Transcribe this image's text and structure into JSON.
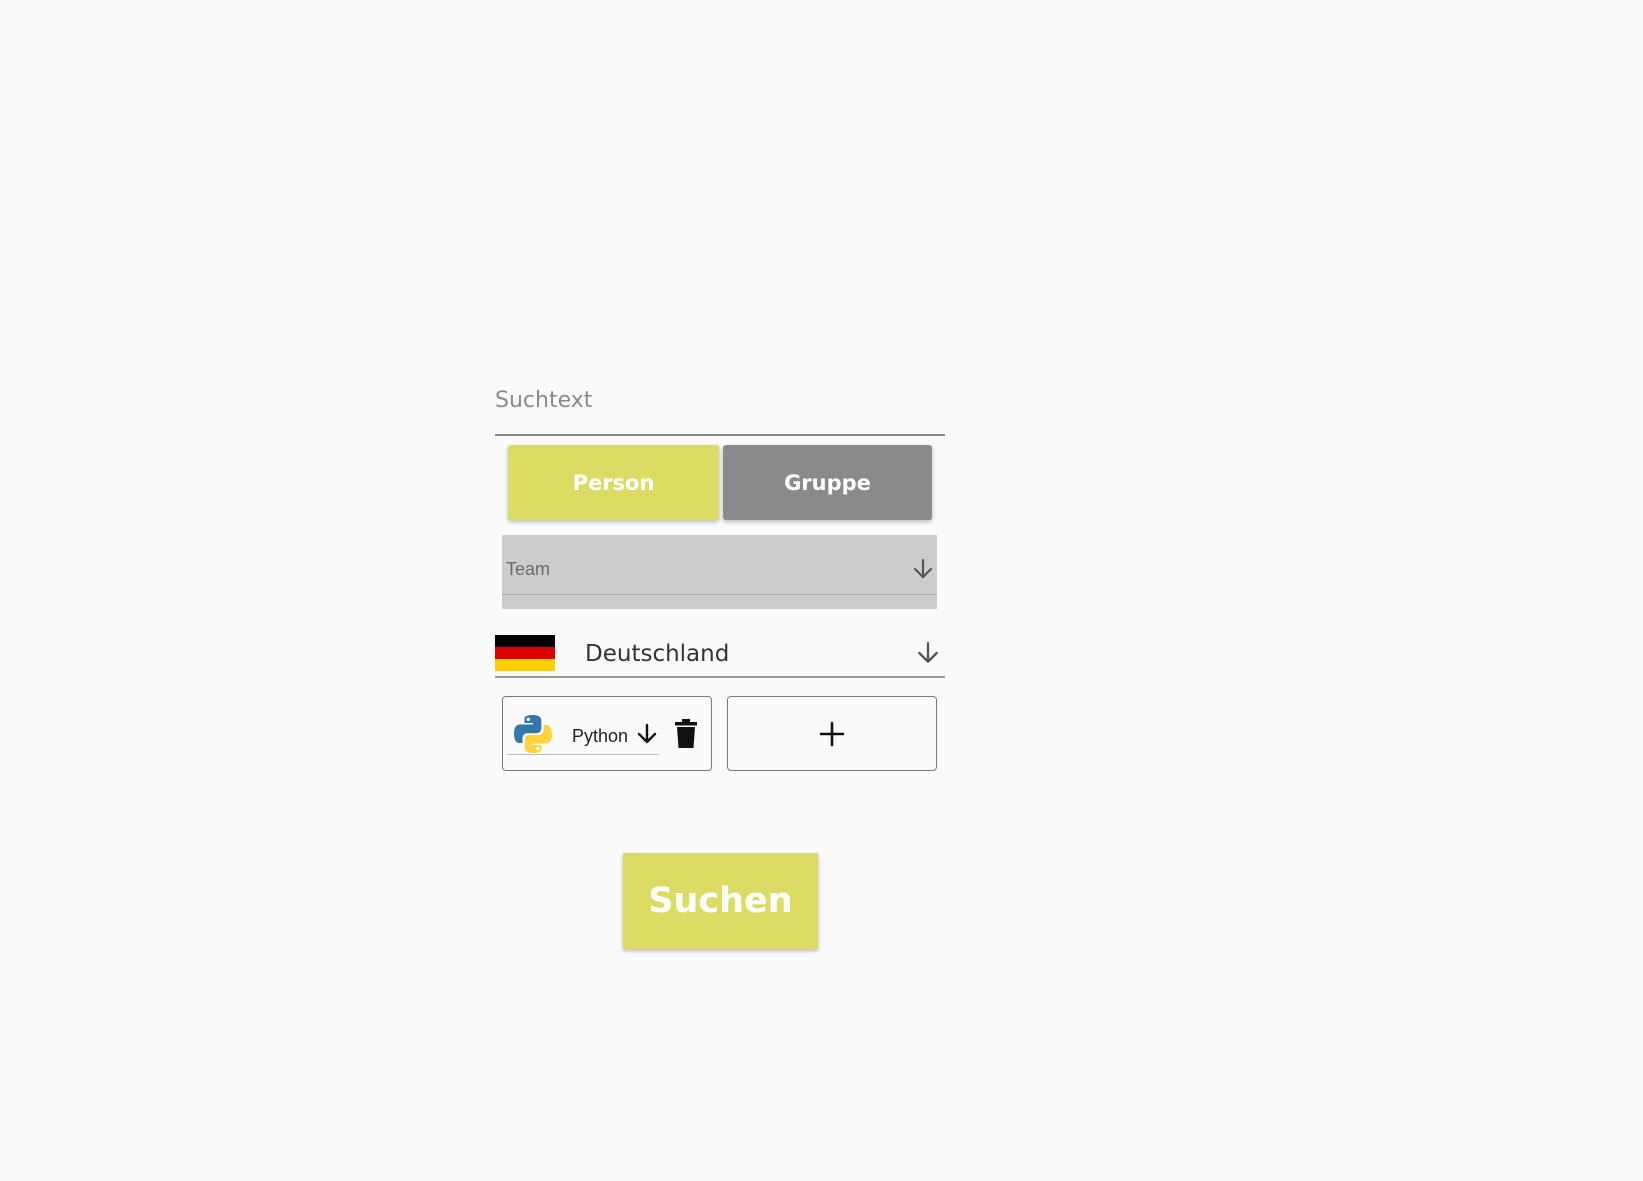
{
  "search": {
    "placeholder": "Suchtext",
    "value": ""
  },
  "toggle": {
    "person_label": "Person",
    "group_label": "Gruppe",
    "selected": "Person",
    "active_color": "#dcdc64",
    "inactive_color": "#8a8a8a"
  },
  "team_select": {
    "label": "Team",
    "icon": "arrow-down-icon"
  },
  "country_select": {
    "value": "Deutschland",
    "flag_icon": "germany-flag-icon",
    "flag_colors": [
      "#000000",
      "#dd0000",
      "#ffce00"
    ],
    "icon": "arrow-down-icon"
  },
  "skills": {
    "items": [
      {
        "label": "Python",
        "icon": "python-logo-icon",
        "dropdown_icon": "arrow-down-icon",
        "delete_icon": "trash-icon"
      }
    ],
    "add_icon": "plus-icon"
  },
  "submit": {
    "label": "Suchen",
    "color": "#dcdc64"
  }
}
